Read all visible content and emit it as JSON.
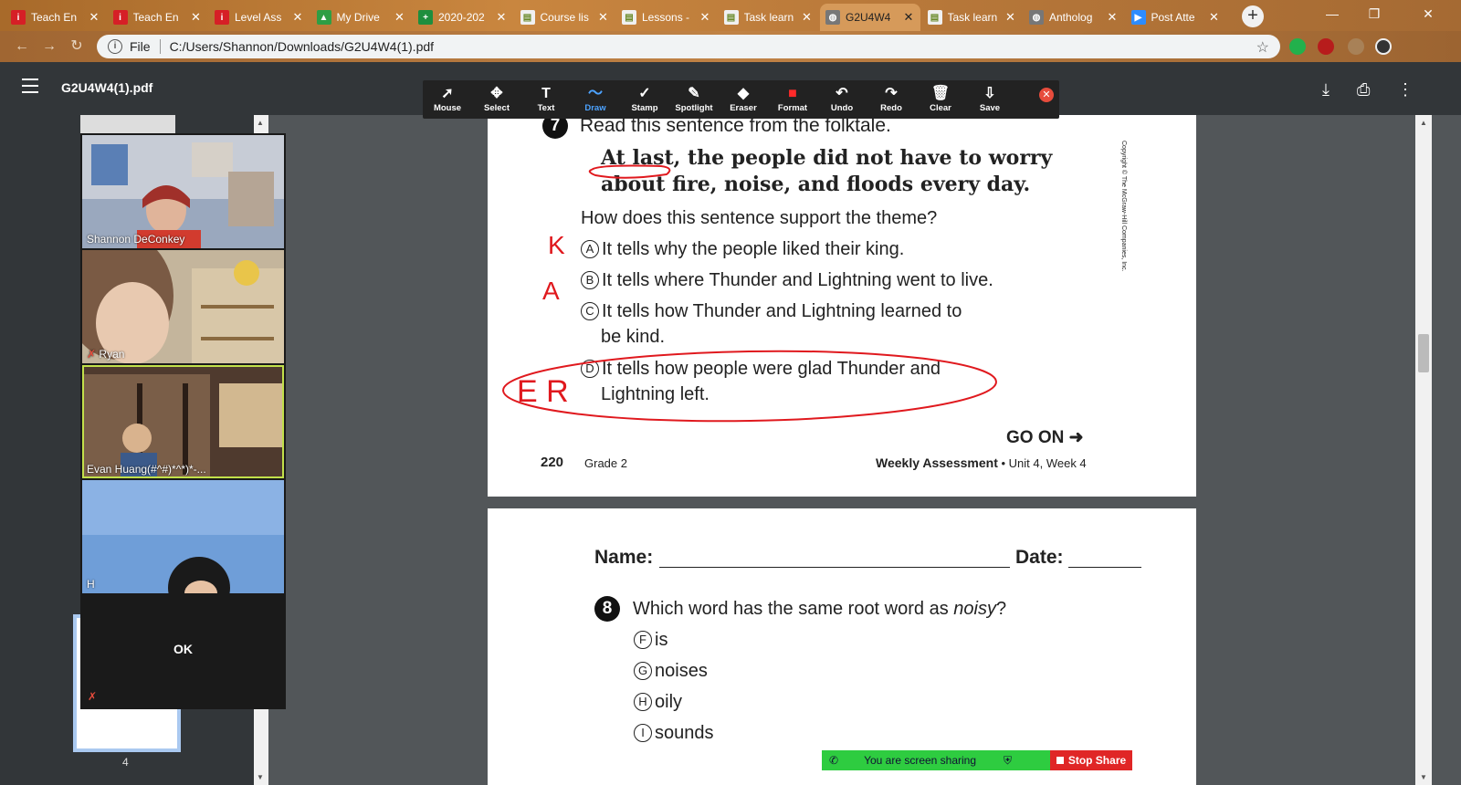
{
  "tabs": [
    {
      "title": "Teach En",
      "icon": "i-icon",
      "color": "#d61f26",
      "glyph": "i"
    },
    {
      "title": "Teach En",
      "icon": "i-icon",
      "color": "#d61f26",
      "glyph": "i"
    },
    {
      "title": "Level Ass",
      "icon": "i-icon",
      "color": "#d61f26",
      "glyph": "i"
    },
    {
      "title": "My Drive",
      "icon": "drive-icon",
      "color": "#2f9e44",
      "glyph": "▲"
    },
    {
      "title": "2020-202",
      "icon": "sheets-icon",
      "color": "#1e8e3e",
      "glyph": "+"
    },
    {
      "title": "Course lis",
      "icon": "classroom-icon",
      "color": "#f0f0f0",
      "glyph": "▤"
    },
    {
      "title": "Lessons -",
      "icon": "classroom-icon",
      "color": "#f0f0f0",
      "glyph": "▤"
    },
    {
      "title": "Task learn",
      "icon": "classroom-icon",
      "color": "#f0f0f0",
      "glyph": "▤"
    },
    {
      "title": "G2U4W4",
      "icon": "globe-icon",
      "color": "#777",
      "glyph": "◍"
    },
    {
      "title": "Task learn",
      "icon": "classroom-icon",
      "color": "#f0f0f0",
      "glyph": "▤"
    },
    {
      "title": "Antholog",
      "icon": "globe-icon",
      "color": "#777",
      "glyph": "◍"
    },
    {
      "title": "Post Atte",
      "icon": "zoom-icon",
      "color": "#2d8cff",
      "glyph": "▶"
    }
  ],
  "address": {
    "scheme": "File",
    "url": "C:/Users/Shannon/Downloads/G2U4W4(1).pdf"
  },
  "pdf": {
    "title": "G2U4W4(1).pdf",
    "page_number": "4"
  },
  "annotation_tools": [
    {
      "label": "Mouse",
      "icon": "cursor-icon",
      "glyph": "➚"
    },
    {
      "label": "Select",
      "icon": "move-icon",
      "glyph": "✥"
    },
    {
      "label": "Text",
      "icon": "text-icon",
      "glyph": "T"
    },
    {
      "label": "Draw",
      "icon": "draw-icon",
      "glyph": "〜"
    },
    {
      "label": "Stamp",
      "icon": "check-icon",
      "glyph": "✓"
    },
    {
      "label": "Spotlight",
      "icon": "spotlight-icon",
      "glyph": "✎"
    },
    {
      "label": "Eraser",
      "icon": "eraser-icon",
      "glyph": "◆"
    },
    {
      "label": "Format",
      "icon": "format-icon",
      "glyph": "■"
    },
    {
      "label": "Undo",
      "icon": "undo-icon",
      "glyph": "↶"
    },
    {
      "label": "Redo",
      "icon": "redo-icon",
      "glyph": "↷"
    },
    {
      "label": "Clear",
      "icon": "trash-icon",
      "glyph": "🗑"
    },
    {
      "label": "Save",
      "icon": "save-icon",
      "glyph": "⇩"
    }
  ],
  "participants": [
    {
      "name": "Shannon DeConkey",
      "bg": "#8a9bb5"
    },
    {
      "name": "Ryan",
      "bg": "#a08a6a"
    },
    {
      "name": "Evan Huang(#^#)*^*)*-...",
      "bg": "#6a5040"
    },
    {
      "name": "H",
      "bg": "#6f9ed8"
    }
  ],
  "zoom_ok": "OK",
  "page1": {
    "q_number": "7",
    "prompt": "Read this sentence from the folktale.",
    "quote_line1": "At last, the people did not have to worry",
    "quote_line2": "about fire, noise, and floods every day.",
    "question": "How does this sentence support the theme?",
    "options": [
      {
        "letter": "A",
        "text": "It tells why the people liked their king."
      },
      {
        "letter": "B",
        "text": "It tells where Thunder and Lightning went to live."
      },
      {
        "letter": "C",
        "text": "It tells how Thunder and Lightning learned to"
      },
      {
        "letter": "D",
        "text": "It tells how people were glad Thunder and"
      }
    ],
    "option_c_cont": "be kind.",
    "option_d_cont": "Lightning left.",
    "go_on": "GO ON ➜",
    "page_num": "220",
    "grade": "Grade 2",
    "footer_bold": "Weekly Assessment",
    "footer_rest": " • Unit 4, Week 4",
    "copyright": "Copyright © The McGraw-Hill Companies, Inc.",
    "handwriting": [
      "K",
      "A",
      "E R"
    ]
  },
  "page2": {
    "name_label": "Name:",
    "date_label": "Date:",
    "q_number": "8",
    "question_a": "Which word has the same root word as ",
    "question_em": "noisy",
    "question_b": "?",
    "options": [
      {
        "letter": "F",
        "text": "is"
      },
      {
        "letter": "G",
        "text": "noises"
      },
      {
        "letter": "H",
        "text": "oily"
      },
      {
        "letter": "I",
        "text": "sounds"
      }
    ]
  },
  "sharing": {
    "status": "You are screen sharing",
    "stop": "Stop Share"
  },
  "colors": {
    "annotation_red": "#e0191e",
    "draw_blue": "#4da3ff"
  }
}
